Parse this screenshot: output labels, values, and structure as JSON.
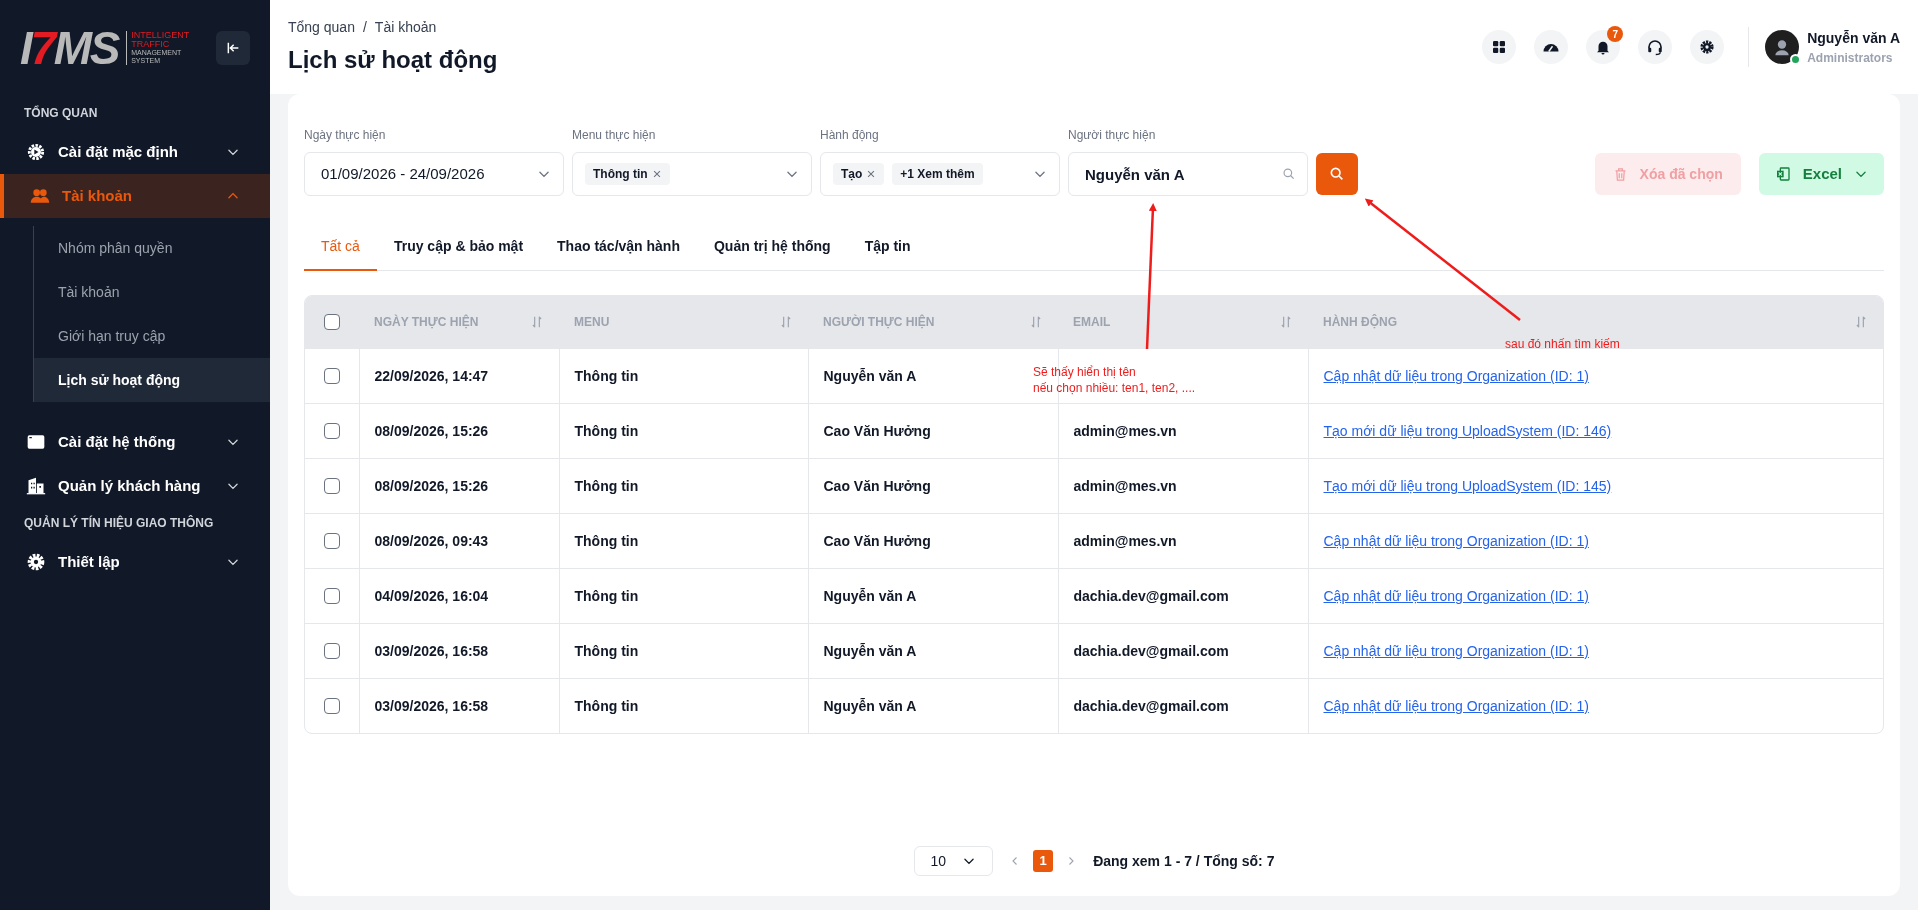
{
  "logo": {
    "mark": [
      "I",
      "7",
      "MS"
    ],
    "tagline": [
      "INTELLIGENT",
      "TRAFFIC",
      "MANAGEMENT",
      "SYSTEM"
    ]
  },
  "sidebar": {
    "sections": [
      {
        "title": "TỔNG QUAN",
        "items": [
          {
            "label": "Cài đặt mặc định",
            "selected": false,
            "expanded": false
          },
          {
            "label": "Tài khoản",
            "selected": true,
            "expanded": true,
            "children": [
              {
                "label": "Nhóm phân quyền",
                "selected": false
              },
              {
                "label": "Tài khoản",
                "selected": false
              },
              {
                "label": "Giới hạn truy cập",
                "selected": false
              },
              {
                "label": "Lịch sử hoạt động",
                "selected": true
              }
            ]
          },
          {
            "label": "Cài đặt hệ thống",
            "selected": false,
            "expanded": false
          },
          {
            "label": "Quản lý khách hàng",
            "selected": false,
            "expanded": false
          }
        ]
      },
      {
        "title": "QUẢN LÝ TÍN HIỆU GIAO THÔNG",
        "items": [
          {
            "label": "Thiết lập",
            "selected": false,
            "expanded": false
          }
        ]
      }
    ]
  },
  "header": {
    "breadcrumb": [
      "Tổng quan",
      "/",
      "Tài khoản"
    ],
    "title": "Lịch sử hoạt động",
    "notification_badge": "7",
    "user": {
      "name": "Nguyễn văn A",
      "role": "Administrators",
      "online": true
    }
  },
  "filters": [
    {
      "kind": "date",
      "label": "Ngày thực hiện",
      "value": "01/09/2026 - 24/09/2026"
    },
    {
      "kind": "tags",
      "label": "Menu thực hiện",
      "tags": [
        {
          "text": "Thông tin",
          "removable": true
        }
      ]
    },
    {
      "kind": "tags",
      "label": "Hành động",
      "tags": [
        {
          "text": "Tạo",
          "removable": true
        },
        {
          "text": "+1 Xem thêm",
          "removable": false
        }
      ]
    },
    {
      "kind": "search",
      "label": "Người thực hiện",
      "value": "Nguyễn văn A"
    }
  ],
  "actions": [
    {
      "kind": "delete",
      "label": "Xóa đã chọn",
      "disabled": true
    },
    {
      "kind": "excel",
      "label": "Excel",
      "disabled": false
    }
  ],
  "tabs": [
    {
      "label": "Tất cả",
      "selected": true
    },
    {
      "label": "Truy cập & bảo mật",
      "selected": false
    },
    {
      "label": "Thao tác/vận hành",
      "selected": false
    },
    {
      "label": "Quản trị hệ thống",
      "selected": false
    },
    {
      "label": "Tập tin",
      "selected": false
    }
  ],
  "table": {
    "all_checked": false,
    "columns": [
      {
        "label": "NGÀY THỰC HIỆN",
        "sortable": true
      },
      {
        "label": "MENU",
        "sortable": true
      },
      {
        "label": "NGƯỜI THỰC HIỆN",
        "sortable": true
      },
      {
        "label": "EMAIL",
        "sortable": true
      },
      {
        "label": "HÀNH ĐỘNG",
        "sortable": true
      }
    ],
    "rows": [
      {
        "checked": false,
        "date": "22/09/2026, 14:47",
        "menu": "Thông tin",
        "user": "Nguyễn văn A",
        "action": "Cập nhật dữ liệu trong Organization (ID: 1)"
      },
      {
        "checked": false,
        "date": "08/09/2026, 15:26",
        "menu": "Thông tin",
        "user": "Cao Văn Hưởng",
        "email": "admin@mes.vn",
        "action": "Tạo mới dữ liệu trong UploadSystem (ID: 146)"
      },
      {
        "checked": false,
        "date": "08/09/2026, 15:26",
        "menu": "Thông tin",
        "user": "Cao Văn Hưởng",
        "email": "admin@mes.vn",
        "action": "Tạo mới dữ liệu trong UploadSystem (ID: 145)"
      },
      {
        "checked": false,
        "date": "08/09/2026, 09:43",
        "menu": "Thông tin",
        "user": "Cao Văn Hưởng",
        "email": "admin@mes.vn",
        "action": "Cập nhật dữ liệu trong Organization (ID: 1)"
      },
      {
        "checked": false,
        "date": "04/09/2026, 16:04",
        "menu": "Thông tin",
        "user": "Nguyễn văn A",
        "email": "dachia.dev@gmail.com",
        "action": "Cập nhật dữ liệu trong Organization (ID: 1)"
      },
      {
        "checked": false,
        "date": "03/09/2026, 16:58",
        "menu": "Thông tin",
        "user": "Nguyễn văn A",
        "email": "dachia.dev@gmail.com",
        "action": "Cập nhật dữ liệu trong Organization (ID: 1)"
      },
      {
        "checked": false,
        "date": "03/09/2026, 16:58",
        "menu": "Thông tin",
        "user": "Nguyễn văn A",
        "email": "dachia.dev@gmail.com",
        "action": "Cập nhật dữ liệu trong Organization (ID: 1)"
      }
    ]
  },
  "pagination": {
    "page_size": "10",
    "pages": [
      {
        "label": "1",
        "selected": true
      }
    ],
    "summary": "Đang xem 1 - 7 / Tổng số: 7"
  },
  "annotations": [
    {
      "lines": [
        "Sẽ thấy hiển thị tên",
        "nếu chọn nhiều: ten1, ten2, ...."
      ]
    },
    {
      "lines": [
        "sau đó nhấn tìm kiếm"
      ]
    }
  ]
}
